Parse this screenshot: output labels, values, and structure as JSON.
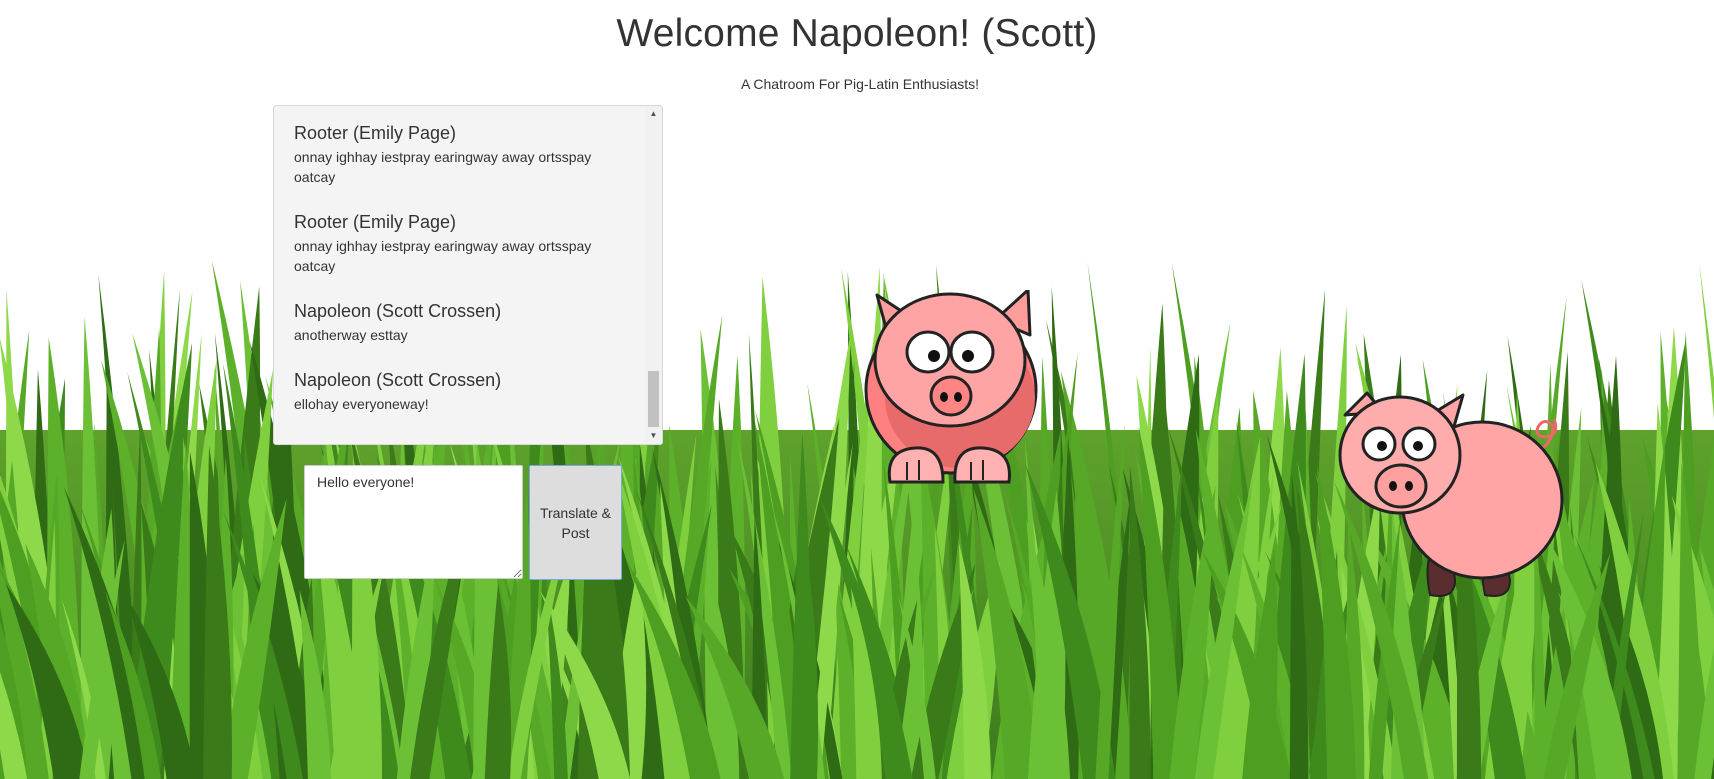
{
  "header": {
    "title": "Welcome Napoleon! (Scott)",
    "subtitle": "A Chatroom For Pig-Latin Enthusiasts!"
  },
  "chat": {
    "messages": [
      {
        "author": "Rooter (Emily Page)",
        "text": "onnay ighhay iestpray earingway away ortsspay oatcay"
      },
      {
        "author": "Rooter (Emily Page)",
        "text": "onnay ighhay iestpray earingway away ortsspay oatcay"
      },
      {
        "author": "Napoleon (Scott Crossen)",
        "text": "anotherway esttay"
      },
      {
        "author": "Napoleon (Scott Crossen)",
        "text": "ellohay everyoneway!"
      }
    ]
  },
  "compose": {
    "value": "Hello everyone!",
    "button_label": "Translate & Post"
  },
  "colors": {
    "grass_light": "#7cc63a",
    "grass_dark": "#3f7f1f",
    "pig_pink": "#fca3a3",
    "panel_bg": "#f4f4f4"
  },
  "icons": {
    "background": "grass-background",
    "pig_front": "pig-front-illustration",
    "pig_side": "pig-side-illustration"
  }
}
